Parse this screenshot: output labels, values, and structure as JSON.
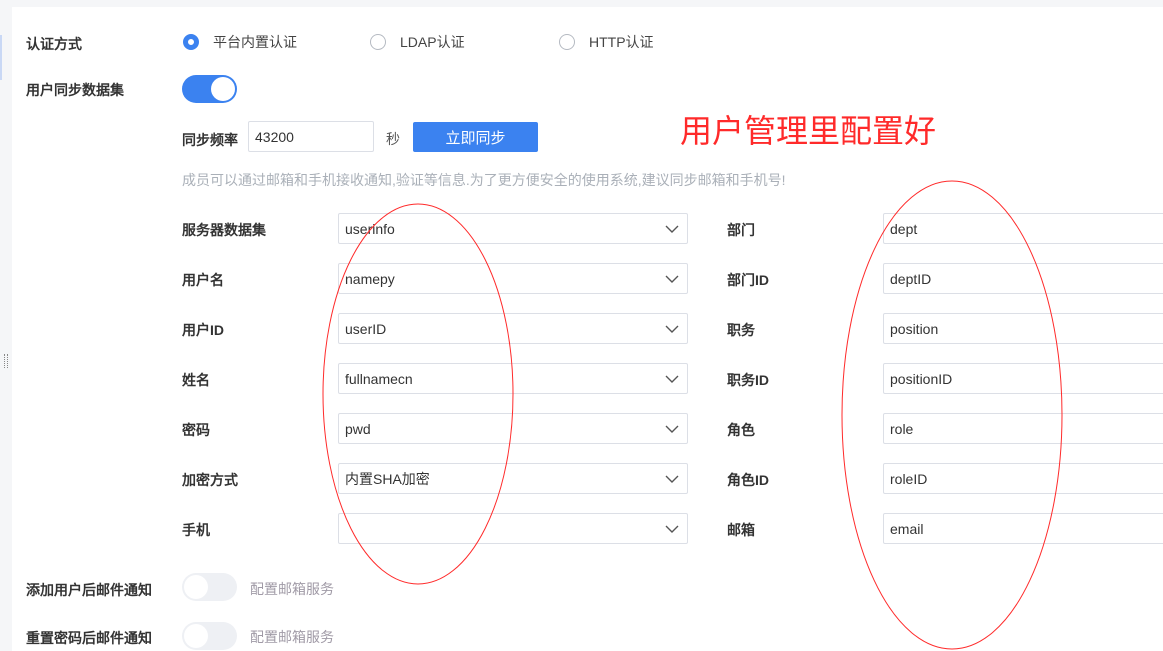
{
  "auth": {
    "label": "认证方式",
    "options": [
      "平台内置认证",
      "LDAP认证",
      "HTTP认证"
    ],
    "selected": 0
  },
  "sync": {
    "label": "用户同步数据集",
    "enabled": true,
    "freq_label": "同步频率",
    "freq_value": "43200",
    "unit": "秒",
    "sync_button": "立即同步",
    "hint": "成员可以通过邮箱和手机接收通知,验证等信息.为了更方便安全的使用系统,建议同步邮箱和手机号!"
  },
  "left_fields": [
    {
      "label": "服务器数据集",
      "value": "userinfo"
    },
    {
      "label": "用户名",
      "value": "namepy"
    },
    {
      "label": "用户ID",
      "value": "userID"
    },
    {
      "label": "姓名",
      "value": "fullnamecn"
    },
    {
      "label": "密码",
      "value": "pwd"
    },
    {
      "label": "加密方式",
      "value": "内置SHA加密"
    },
    {
      "label": "手机",
      "value": ""
    }
  ],
  "right_fields": [
    {
      "label": "部门",
      "value": "dept"
    },
    {
      "label": "部门ID",
      "value": "deptID"
    },
    {
      "label": "职务",
      "value": "position"
    },
    {
      "label": "职务ID",
      "value": "positionID"
    },
    {
      "label": "角色",
      "value": "role"
    },
    {
      "label": "角色ID",
      "value": "roleID"
    },
    {
      "label": "邮箱",
      "value": "email"
    }
  ],
  "notify": [
    {
      "label": "添加用户后邮件通知",
      "enabled": false,
      "link": "配置邮箱服务"
    },
    {
      "label": "重置密码后邮件通知",
      "enabled": false,
      "link": "配置邮箱服务"
    }
  ],
  "annotation": "用户管理里配置好"
}
